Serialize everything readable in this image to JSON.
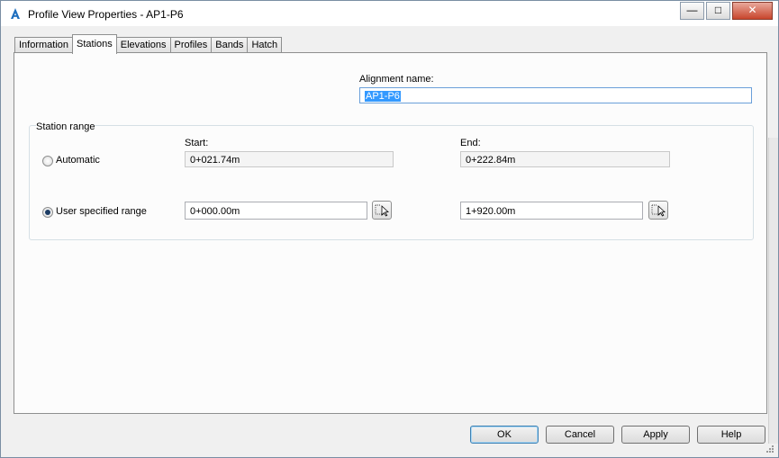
{
  "window": {
    "title": "Profile View Properties - AP1-P6"
  },
  "title_buttons": {
    "minimize": "—",
    "maximize": "□",
    "close": "✕"
  },
  "tabs": [
    {
      "label": "Information"
    },
    {
      "label": "Stations"
    },
    {
      "label": "Elevations"
    },
    {
      "label": "Profiles"
    },
    {
      "label": "Bands"
    },
    {
      "label": "Hatch"
    }
  ],
  "active_tab": "Stations",
  "alignment": {
    "label": "Alignment name:",
    "value": "AP1-P6"
  },
  "station_range": {
    "legend": "Station range",
    "start_label": "Start:",
    "end_label": "End:",
    "automatic": {
      "label": "Automatic",
      "start": "0+021.74m",
      "end": "0+222.84m",
      "selected": false
    },
    "user": {
      "label": "User specified range",
      "start": "0+000.00m",
      "end": "1+920.00m",
      "selected": true
    }
  },
  "buttons": {
    "ok": "OK",
    "cancel": "Cancel",
    "apply": "Apply",
    "help": "Help"
  },
  "colors": {
    "accent": "#3399ff",
    "app_icon": "#1f6fbf"
  }
}
